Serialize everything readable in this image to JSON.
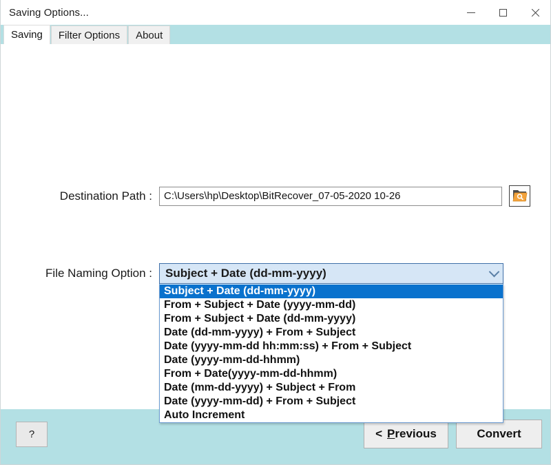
{
  "window": {
    "title": "Saving Options...",
    "controls": {
      "minimize": "minimize-icon",
      "maximize": "maximize-icon",
      "close": "close-icon"
    },
    "accent_teal": "#b3e0e4",
    "accent_selection": "#0a72cd",
    "accent_browse_orange": "#f3a33c"
  },
  "tabs": [
    {
      "label": "Saving",
      "active": true
    },
    {
      "label": "Filter Options",
      "active": false
    },
    {
      "label": "About",
      "active": false
    }
  ],
  "form": {
    "destination": {
      "label": "Destination Path :",
      "value": "C:\\Users\\hp\\Desktop\\BitRecover_07-05-2020 10-26",
      "placeholder": "",
      "browse_icon": "folder-search-icon"
    },
    "naming": {
      "label": "File Naming Option :",
      "selected": "Subject + Date (dd-mm-yyyy)",
      "expanded": true,
      "dropdown_icon": "chevron-down-icon",
      "options": [
        "Subject + Date (dd-mm-yyyy)",
        "From + Subject + Date (yyyy-mm-dd)",
        "From + Subject + Date (dd-mm-yyyy)",
        "Date (dd-mm-yyyy) + From + Subject",
        "Date (yyyy-mm-dd hh:mm:ss) + From + Subject",
        "Date (yyyy-mm-dd-hhmm)",
        "From + Date(yyyy-mm-dd-hhmm)",
        "Date (mm-dd-yyyy) + Subject + From",
        "Date (yyyy-mm-dd) + From + Subject",
        "Auto Increment"
      ]
    }
  },
  "footer": {
    "help_label": "?",
    "previous_prefix": "<",
    "previous_accel": "P",
    "previous_rest": "revious",
    "convert_label": "Convert"
  }
}
